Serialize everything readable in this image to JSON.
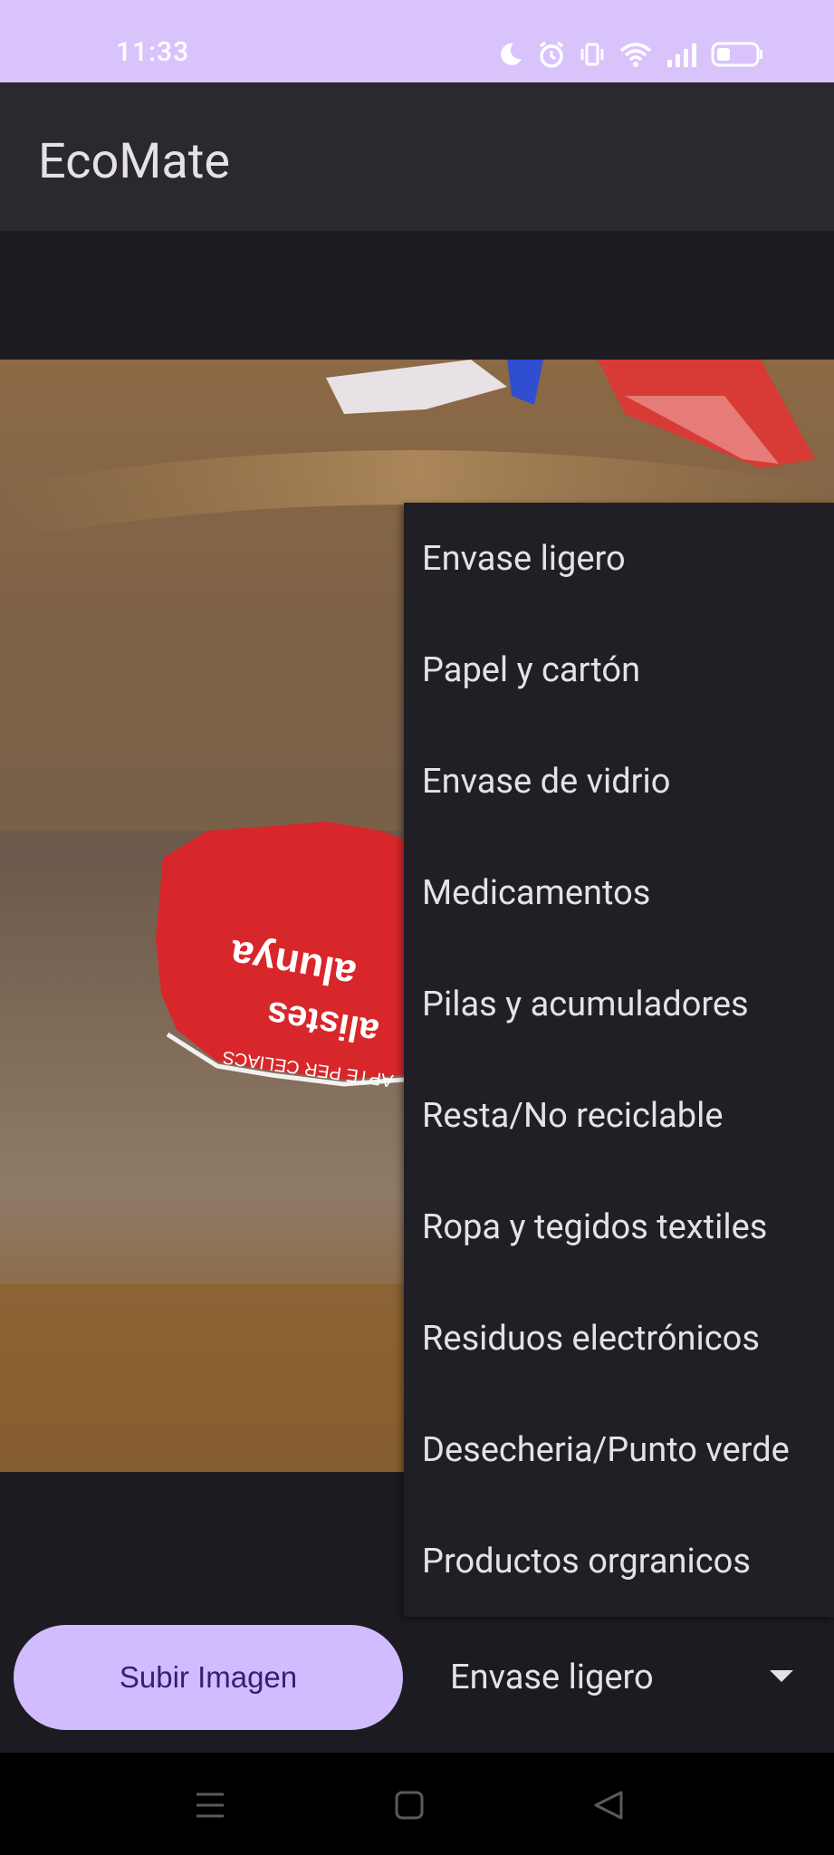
{
  "status_bar": {
    "time": "11:33",
    "icons": [
      "moon-icon",
      "alarm-icon",
      "vibrate-icon",
      "wifi-icon",
      "signal-icon",
      "battery-icon"
    ]
  },
  "app_bar": {
    "title": "EcoMate"
  },
  "dropdown_menu": {
    "items": [
      "Envase ligero",
      "Papel y cartón",
      "Envase de vidrio",
      "Medicamentos",
      "Pilas y acumuladores",
      "Resta/No reciclable",
      "Ropa y tegidos textiles",
      "Residuos electrónicos",
      "Desecheria/Punto verde",
      "Productos orgranicos"
    ]
  },
  "controls": {
    "upload_label": "Subir Imagen",
    "selected_category": "Envase ligero"
  },
  "nav_bar": {
    "icons": [
      "menu-icon",
      "home-icon",
      "back-icon"
    ]
  },
  "colors": {
    "status_bar": "#d8c4fb",
    "app_bar": "#2b2930",
    "background": "#1d1b22",
    "menu": "#211f26",
    "button": "#d0bcff",
    "button_text": "#381e72"
  }
}
